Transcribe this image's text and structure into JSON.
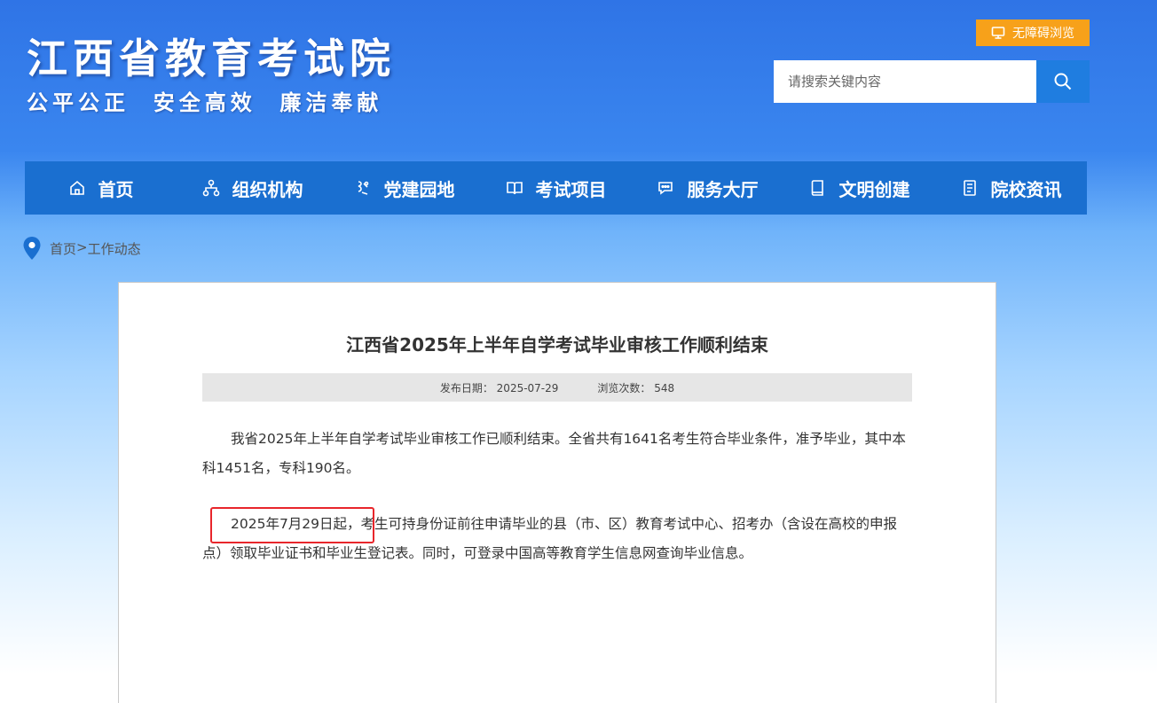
{
  "header": {
    "site_title": "江西省教育考试院",
    "slogan": "公平公正  安全高效  廉洁奉献",
    "accessibility_label": "无障碍浏览",
    "search_placeholder": "请搜索关键内容"
  },
  "nav": {
    "items": [
      {
        "label": "首页",
        "icon": "home-icon"
      },
      {
        "label": "组织机构",
        "icon": "org-chart-icon"
      },
      {
        "label": "党建园地",
        "icon": "party-icon"
      },
      {
        "label": "考试项目",
        "icon": "book-open-icon"
      },
      {
        "label": "服务大厅",
        "icon": "chat-icon"
      },
      {
        "label": "文明创建",
        "icon": "book-icon"
      },
      {
        "label": "院校资讯",
        "icon": "document-icon"
      }
    ]
  },
  "breadcrumb": {
    "home": "首页",
    "separator": ">",
    "current": "工作动态"
  },
  "article": {
    "title": "江西省2025年上半年自学考试毕业审核工作顺利结束",
    "publish_date_label": "发布日期：",
    "publish_date": "2025-07-29",
    "views_label": "浏览次数：",
    "views": "548",
    "paragraph1": "我省2025年上半年自学考试毕业审核工作已顺利结束。全省共有1641名考生符合毕业条件，准予毕业，其中本科1451名，专科190名。",
    "paragraph2_highlight": "2025年7月29日起，",
    "paragraph2_rest": "考生可持身份证前往申请毕业的县（市、区）教育考试中心、招考办（含设在高校的申报点）领取毕业证书和毕业生登记表。同时，可登录中国高等教育学生信息网查询毕业信息。"
  },
  "colors": {
    "nav_bg": "#1a6fd0",
    "access_btn": "#f7a11a",
    "search_btn": "#1f7de0",
    "highlight_border": "#e8262b"
  }
}
